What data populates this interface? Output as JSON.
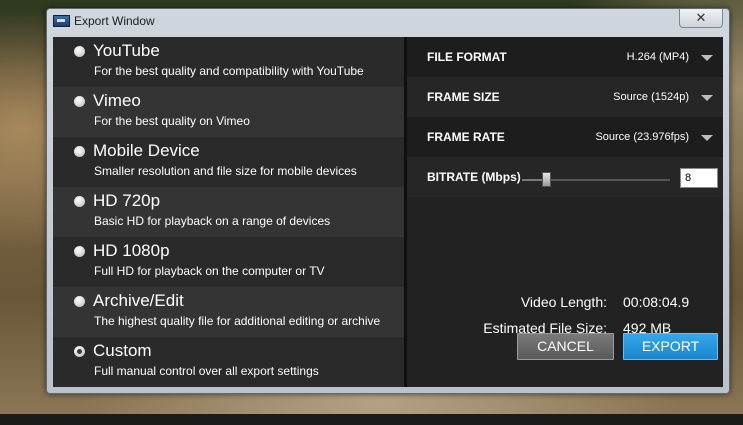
{
  "window": {
    "title": "Export Window",
    "close_label": "✕"
  },
  "presets": [
    {
      "title": "YouTube",
      "description": "For the best quality and compatibility with YouTube",
      "selected": false
    },
    {
      "title": "Vimeo",
      "description": "For the best quality on Vimeo",
      "selected": false
    },
    {
      "title": "Mobile Device",
      "description": "Smaller resolution and file size for mobile devices",
      "selected": false
    },
    {
      "title": "HD 720p",
      "description": "Basic HD for playback on a range of devices",
      "selected": false
    },
    {
      "title": "HD 1080p",
      "description": "Full HD for playback on the computer or TV",
      "selected": false
    },
    {
      "title": "Archive/Edit",
      "description": "The highest quality file for additional editing or archive",
      "selected": false
    },
    {
      "title": "Custom",
      "description": "Full manual control over all export settings",
      "selected": true
    }
  ],
  "settings": {
    "file_format": {
      "label": "FILE FORMAT",
      "value": "H.264 (MP4)"
    },
    "frame_size": {
      "label": "FRAME SIZE",
      "value": "Source (1524p)"
    },
    "frame_rate": {
      "label": "FRAME RATE",
      "value": "Source (23.976fps)"
    },
    "bitrate": {
      "label": "BITRATE (Mbps)",
      "value": "8",
      "slider_fraction": 0.16
    }
  },
  "info": {
    "video_length_label": "Video Length:",
    "video_length_value": "00:08:04.9",
    "file_size_label": "Estimated File Size:",
    "file_size_value": "492 MB"
  },
  "buttons": {
    "cancel": "CANCEL",
    "export": "EXPORT"
  }
}
